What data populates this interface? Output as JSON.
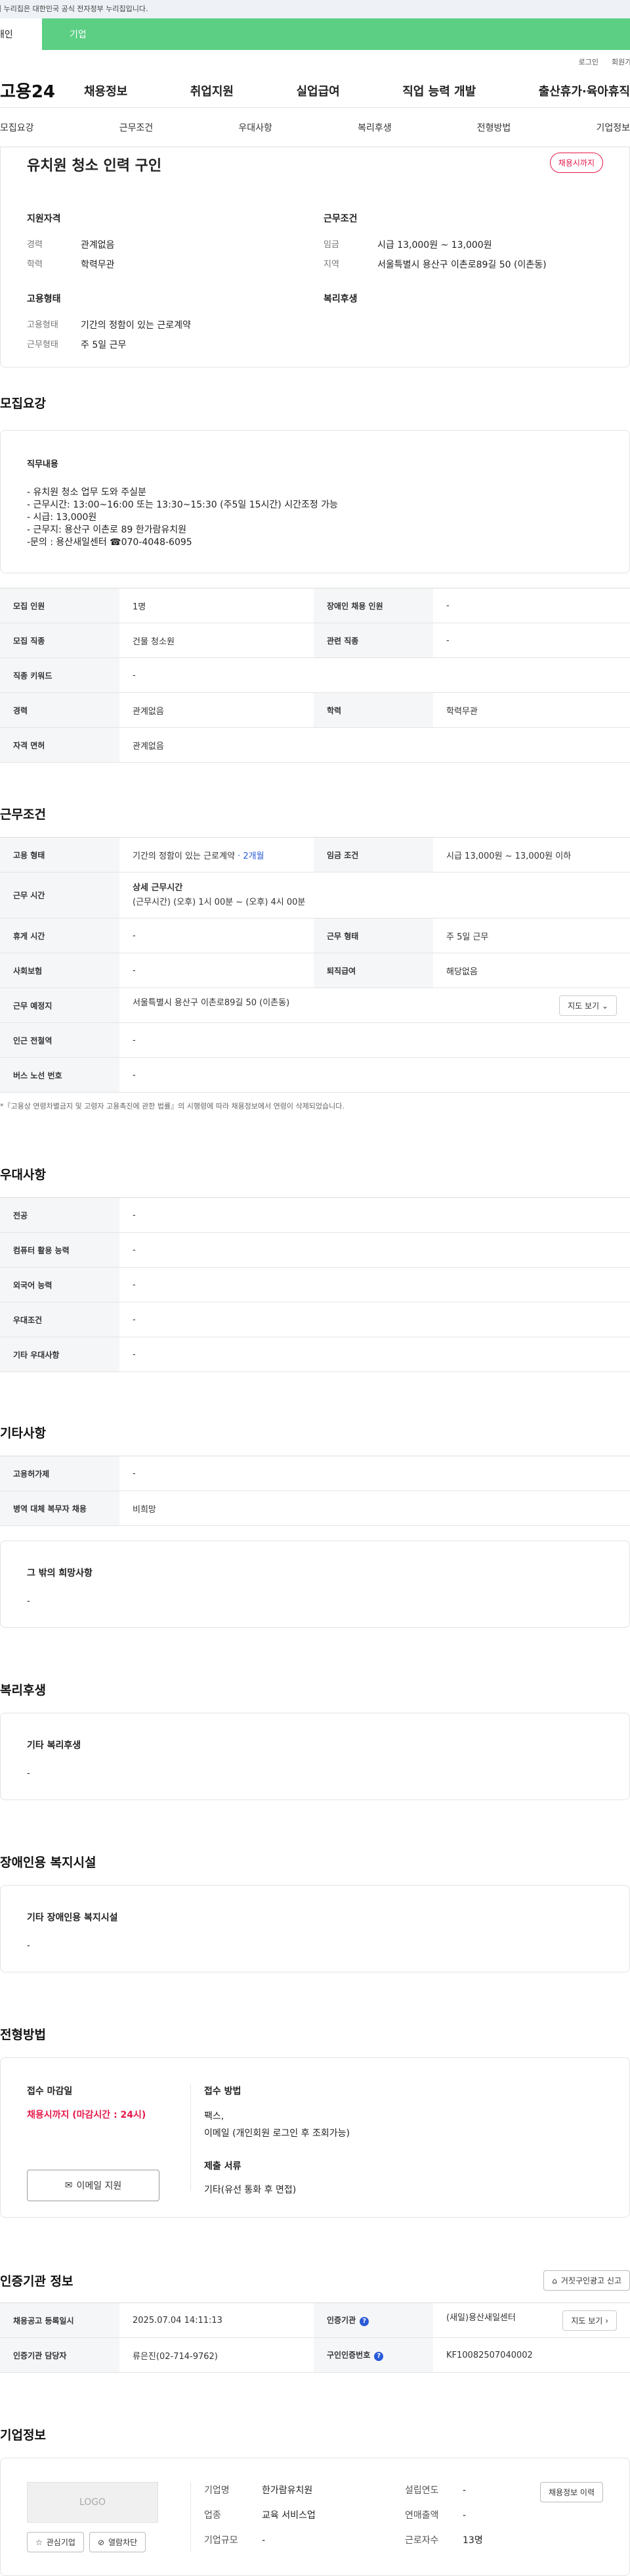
{
  "gov_banner": "이 누리집은 대한민국 공식 전자정부 누리집입니다.",
  "tabs": {
    "person": "개인",
    "company": "기업"
  },
  "util": {
    "login": "로그인",
    "join": "회원가입"
  },
  "logo": "고용24",
  "gnb": [
    "채용정보",
    "취업지원",
    "실업급여",
    "직업 능력 개발",
    "출산휴가·육아휴직"
  ],
  "subnav": [
    "모집요강",
    "근무조건",
    "우대사항",
    "복리후생",
    "전형방법",
    "기업정보"
  ],
  "summary": {
    "title": "유치원 청소 인력 구인",
    "status": "채용시까지",
    "qual_title": "지원자격",
    "qual": [
      {
        "k": "경력",
        "v": "관계없음"
      },
      {
        "k": "학력",
        "v": "학력무관"
      }
    ],
    "emp_title": "고용형태",
    "emp": [
      {
        "k": "고용형태",
        "v": "기간의 정함이 있는 근로계약"
      },
      {
        "k": "근무형태",
        "v": "주 5일 근무"
      }
    ],
    "cond_title": "근무조건",
    "cond": [
      {
        "k": "임금",
        "v": "시급 13,000원 ~ 13,000원"
      },
      {
        "k": "지역",
        "v": "서울특별시 용산구 이촌로89길 50 (이촌동)"
      }
    ],
    "welfare_title": "복리후생"
  },
  "recruit": {
    "title": "모집요강",
    "desc_title": "직무내용",
    "desc_lines": [
      "- 유치원 청소 업무 도와 주실분",
      "-  근무시간: 13:00~16:00 또는 13:30~15:30 (주5일 15시간) 시간조정 가능",
      "- 시급: 13,000원",
      "- 근무지: 용산구 이촌로 89 한가람유치원",
      "-문의 : 용산새일센터 ☎070-4048-6095"
    ],
    "rows": [
      {
        "k1": "모집 인원",
        "v1": "1명",
        "k2": "장애인 채용 인원",
        "v2": "-"
      },
      {
        "k1": "모집 직종",
        "v1": "건물 청소원",
        "k2": "관련 직종",
        "v2": "-"
      },
      {
        "k1": "직종 키워드",
        "v1": "-"
      },
      {
        "k1": "경력",
        "v1": "관계없음",
        "k2": "학력",
        "v2": "학력무관"
      },
      {
        "k1": "자격 면허",
        "v1": "관계없음"
      }
    ]
  },
  "work": {
    "title": "근무조건",
    "emp_k": "고용 형태",
    "emp_v": "기간의 정함이 있는 근로계약",
    "emp_months": " · 2개월",
    "wage_k": "임금 조건",
    "wage_v": "시급 13,000원 ~ 13,000원 이하",
    "time_k": "근무 시간",
    "time_title": "상세 근무시간",
    "time_v": "(근무시간) (오후) 1시 00분 ~ (오후) 4시 00분",
    "rest_k": "휴게 시간",
    "rest_v": "-",
    "form_k": "근무 형태",
    "form_v": "주 5일 근무",
    "ins_k": "사회보험",
    "ins_v": "-",
    "sev_k": "퇴직급여",
    "sev_v": "해당없음",
    "place_k": "근무 예정지",
    "place_v": "서울특별시 용산구 이촌로89길 50 (이촌동)",
    "map_btn": "지도 보기",
    "sub_k": "인근 전철역",
    "sub_v": "-",
    "bus_k": "버스 노선 번호",
    "bus_v": "-",
    "note": "*『고용상 연령차별금지 및 고령자 고용촉진에 관한 법률』의 시행령에 따라 채용정보에서 연령이 삭제되었습니다."
  },
  "pref": {
    "title": "우대사항",
    "rows": [
      {
        "k": "전공",
        "v": "-"
      },
      {
        "k": "컴퓨터 활용 능력",
        "v": "-"
      },
      {
        "k": "외국어 능력",
        "v": "-"
      },
      {
        "k": "우대조건",
        "v": "-"
      },
      {
        "k": "기타 우대사항",
        "v": "-"
      }
    ]
  },
  "etc": {
    "title": "기타사항",
    "rows": [
      {
        "k": "고용허가제",
        "v": "-"
      },
      {
        "k": "병역 대체 복무자 채용",
        "v": "비희망"
      }
    ],
    "card_title": "그 밖의 희망사항",
    "card_v": "-"
  },
  "welfare": {
    "title": "복리후생",
    "card_title": "기타 복리후생",
    "card_v": "-"
  },
  "disabled": {
    "title": "장애인용 복지시설",
    "card_title": "기타 장애인용 복지시설",
    "card_v": "-"
  },
  "selection": {
    "title": "전형방법",
    "deadline_k": "접수 마감일",
    "deadline_v": "채용시까지 (마감시간 : 24시)",
    "email_btn": "이메일 지원",
    "method_k": "접수 방법",
    "method_v1": "팩스,",
    "method_v2": "이메일 (개인회원 로그인 후 조회가능)",
    "docs_k": "제출 서류",
    "docs_v": "기타(유선 통화 후 면접)"
  },
  "cert": {
    "title": "인증기관 정보",
    "report_btn": "거짓구인광고 신고",
    "reg_k": "채용공고 등록일시",
    "reg_v": "2025.07.04 14:11:13",
    "org_k": "인증기관",
    "org_v": "(새일)용산새일센터",
    "map_btn": "지도 보기",
    "mgr_k": "인증기관 담당자",
    "mgr_v": "류은진(02-714-9762)",
    "num_k": "구인인증번호",
    "num_v": "KF10082507040002"
  },
  "company": {
    "title": "기업정보",
    "logo": "LOGO",
    "fav_btn": "관심기업",
    "block_btn": "열람차단",
    "history_btn": "채용정보 이력",
    "rows": [
      {
        "k1": "기업명",
        "v1": "한가람유치원",
        "k2": "설립연도",
        "v2": "-"
      },
      {
        "k1": "업종",
        "v1": "교육 서비스업",
        "k2": "연매출액",
        "v2": "-"
      },
      {
        "k1": "기업규모",
        "v1": "-",
        "k2": "근로자수",
        "v2": "13명"
      }
    ]
  },
  "colors": {
    "accent_green": "#5ccf84",
    "status_pink": "#e6194b",
    "link_blue": "#2a5bd7"
  }
}
